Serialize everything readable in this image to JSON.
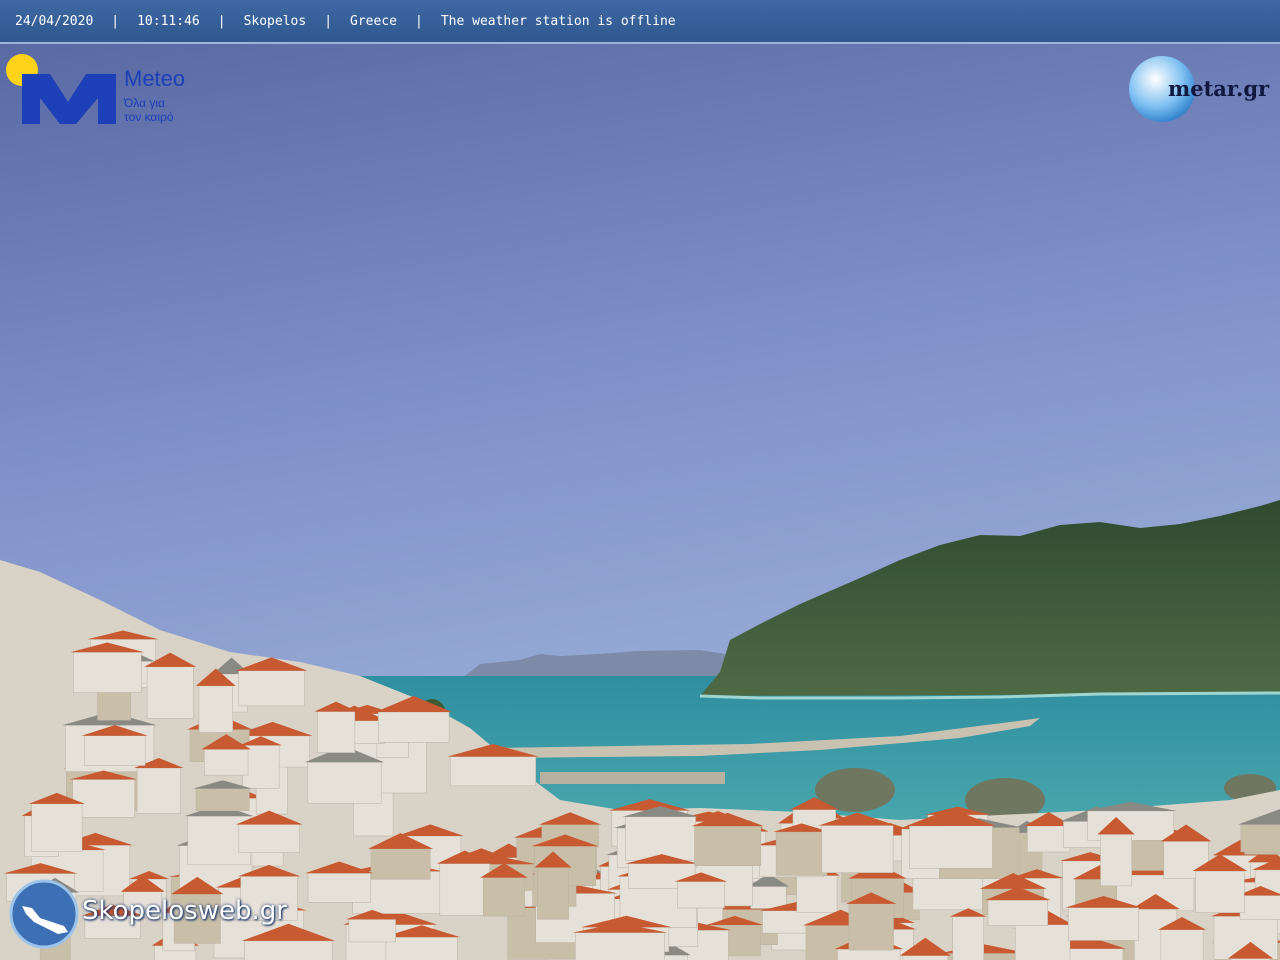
{
  "overlay": {
    "date": "24/04/2020",
    "time": "10:11:46",
    "location": "Skopelos",
    "country": "Greece",
    "status": "The weather station is offline",
    "separator": "|"
  },
  "logos": {
    "meteo": {
      "title": "Meteo",
      "tagline_line1": "Όλα για",
      "tagline_line2": "τον καιρό"
    },
    "metar": {
      "text": "metar.gr"
    },
    "skopelosweb": {
      "text": "Skopelosweb.gr"
    }
  },
  "colors": {
    "sky_top": "#5a6aa8",
    "sky_bottom": "#8a9ed0",
    "sea": "#3f9aa6",
    "mountain": "#3c5a38",
    "roof": "#c85a32",
    "wall": "#e6e1d8",
    "overlay_bar": "#3a639e"
  }
}
